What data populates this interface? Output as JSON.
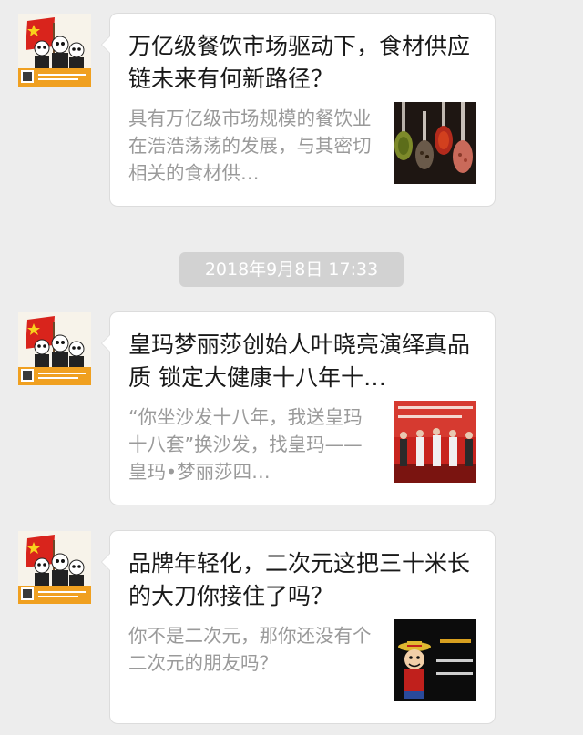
{
  "messages": [
    {
      "title": "万亿级餐饮市场驱动下，食材供应链未来有何新路径？",
      "description": "具有万亿级市场规模的餐饮业在浩浩荡荡的发展，与其密切相关的食材供…",
      "thumbnail_icon": "spoons-with-spices-image",
      "avatar_icon": "panda-mascot-avatar"
    },
    {
      "title": "皇玛梦丽莎创始人叶晓亮演绎真品质 锁定大健康十八年十…",
      "description": "“你坐沙发十八年，我送皇玛十八套”换沙发，找皇玛——皇玛•梦丽莎四…",
      "thumbnail_icon": "stage-event-photo",
      "avatar_icon": "panda-mascot-avatar"
    },
    {
      "title": "品牌年轻化，二次元这把三十米长的大刀你接住了吗？",
      "description": "你不是二次元，那你还没有个二次元的朋友吗？",
      "thumbnail_icon": "anime-character-image",
      "avatar_icon": "panda-mascot-avatar"
    }
  ],
  "timestamp": "2018年9月8日 17:33",
  "colors": {
    "background": "#ededed",
    "card": "#ffffff",
    "title_text": "#191919",
    "desc_text": "#9a9a9a",
    "timestamp_bg": "#d2d2d2",
    "flag_red": "#d9241c",
    "avatar_band": "#f0a020"
  }
}
